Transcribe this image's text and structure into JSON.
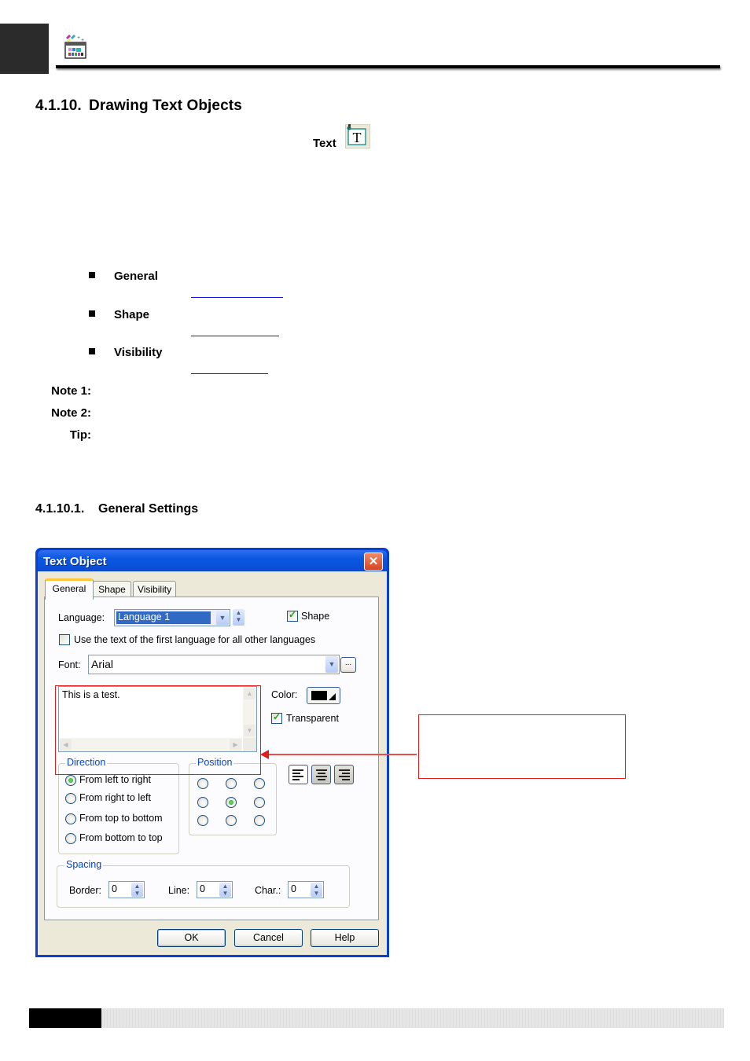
{
  "header": {
    "logo_icon": "toolbox-palette-icon"
  },
  "section": {
    "number": "4.1.10.",
    "title": "Drawing Text Objects",
    "tool_label": "Text",
    "tool_icon": "text-tool-icon"
  },
  "property_list": [
    {
      "label": "General"
    },
    {
      "label": "Shape"
    },
    {
      "label": "Visibility"
    }
  ],
  "notes": [
    {
      "label": "Note 1:"
    },
    {
      "label": "Note 2:"
    },
    {
      "label": "Tip:"
    }
  ],
  "subsection": {
    "number": "4.1.10.1.",
    "title": "General Settings"
  },
  "dialog": {
    "title": "Text Object",
    "close_symbol": "✕",
    "tabs": [
      {
        "label": "General",
        "active": true
      },
      {
        "label": "Shape",
        "active": false
      },
      {
        "label": "Visibility",
        "active": false
      }
    ],
    "language": {
      "label": "Language:",
      "value": "Language 1"
    },
    "shape_checkbox": {
      "label": "Shape",
      "checked": true
    },
    "use_first_language": {
      "label": "Use the text of the first language for all other languages",
      "checked": false
    },
    "font": {
      "label": "Font:",
      "value": "Arial",
      "browse_label": "..."
    },
    "text_content": "This is a test.",
    "color": {
      "label": "Color:",
      "value": "#000000"
    },
    "transparent": {
      "label": "Transparent",
      "checked": true
    },
    "direction": {
      "title": "Direction",
      "options": [
        {
          "label": "From left to right",
          "selected": true
        },
        {
          "label": "From right to left",
          "selected": false
        },
        {
          "label": "From top to bottom",
          "selected": false
        },
        {
          "label": "From bottom to top",
          "selected": false
        }
      ]
    },
    "position": {
      "title": "Position",
      "selected_row": 2,
      "selected_col": 2
    },
    "alignment": {
      "options": [
        "align-left",
        "align-center",
        "align-right"
      ],
      "selected": "align-left"
    },
    "spacing": {
      "title": "Spacing",
      "border": {
        "label": "Border:",
        "value": "0"
      },
      "line": {
        "label": "Line:",
        "value": "0"
      },
      "char": {
        "label": "Char.:",
        "value": "0"
      }
    },
    "buttons": {
      "ok": "OK",
      "cancel": "Cancel",
      "help": "Help"
    }
  },
  "annotation": {
    "highlight_color": "#e01c1c",
    "callout_text": ""
  }
}
